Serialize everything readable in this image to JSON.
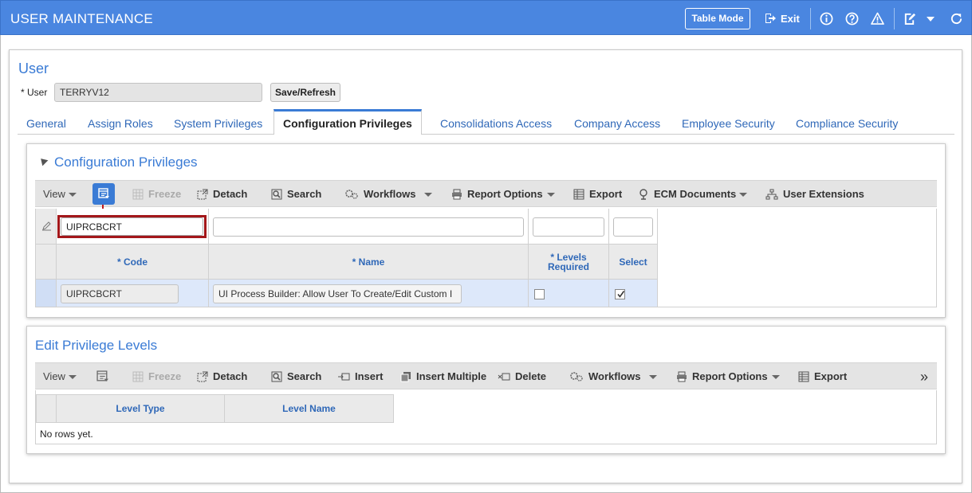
{
  "header": {
    "title": "USER MAINTENANCE",
    "table_mode": "Table Mode",
    "exit": "Exit",
    "icons": [
      "info-icon",
      "help-icon",
      "warning-icon",
      "notes-icon",
      "chevron-down-icon",
      "refresh-icon"
    ]
  },
  "user": {
    "heading": "User",
    "label": "* User",
    "value": "TERRYV12",
    "save_refresh": "Save/Refresh"
  },
  "tabs": [
    {
      "label": "General"
    },
    {
      "label": "Assign Roles"
    },
    {
      "label": "System Privileges"
    },
    {
      "label": "Configuration Privileges",
      "active": true
    },
    {
      "label": "Consolidations Access"
    },
    {
      "label": "Company Access"
    },
    {
      "label": "Employee Security"
    },
    {
      "label": "Compliance Security"
    }
  ],
  "config": {
    "title": "Configuration Privileges",
    "toolbar": {
      "view": "View",
      "freeze": "Freeze",
      "detach": "Detach",
      "search": "Search",
      "workflows": "Workflows",
      "report_options": "Report Options",
      "export": "Export",
      "ecm_documents": "ECM Documents",
      "user_extensions": "User Extensions"
    },
    "filter": {
      "code": "UIPRCBCRT",
      "name": "",
      "levels_required": "",
      "select": ""
    },
    "columns": {
      "code": "* Code",
      "name": "* Name",
      "levels_required": "* Levels Required",
      "select": "Select"
    },
    "rows": [
      {
        "code": "UIPRCBCRT",
        "name": "UI Process Builder: Allow User To Create/Edit Custom I",
        "levels_required": false,
        "select": true
      }
    ]
  },
  "levels": {
    "title": "Edit Privilege Levels",
    "toolbar": {
      "view": "View",
      "freeze": "Freeze",
      "detach": "Detach",
      "search": "Search",
      "insert": "Insert",
      "insert_multiple": "Insert Multiple",
      "delete": "Delete",
      "workflows": "Workflows",
      "report_options": "Report Options",
      "export": "Export",
      "more": "»"
    },
    "columns": {
      "level_type": "Level Type",
      "level_name": "Level Name"
    },
    "empty": "No rows yet."
  },
  "colors": {
    "header_bg": "#4a86e0",
    "accent": "#3a7bd5",
    "highlight_border": "#a3171a",
    "selected_row": "#dde8fa"
  }
}
